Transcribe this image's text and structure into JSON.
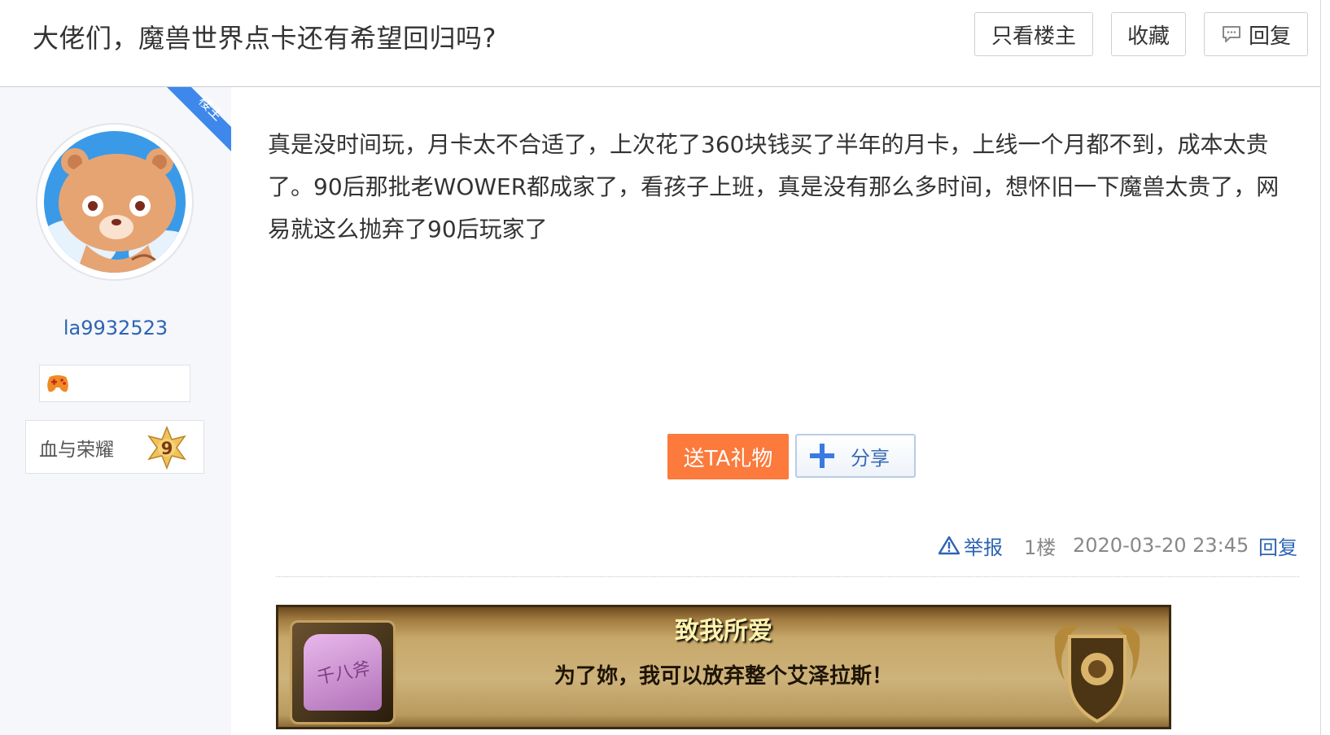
{
  "thread": {
    "title": "大佬们，魔兽世界点卡还有希望回归吗?",
    "actions": {
      "only_op": "只看楼主",
      "favorite": "收藏",
      "reply": "回复"
    }
  },
  "author": {
    "badge": "楼主",
    "username": "la9932523",
    "rank_name": "血与荣耀",
    "level": "9"
  },
  "post": {
    "content": "真是没时间玩，月卡太不合适了，上次花了360块钱买了半年的月卡，上线一个月都不到，成本太贵了。90后那批老WOWER都成家了，看孩子上班，真是没有那么多时间，想怀旧一下魔兽太贵了，网易就这么抛弃了90后玩家了",
    "gift_button": "送TA礼物",
    "share_button": "分享",
    "report": "举报",
    "floor": "1楼",
    "time": "2020-03-20 23:45",
    "reply": "回复"
  },
  "signature": {
    "title": "致我所爱",
    "subtitle": "为了妳，我可以放弃整个艾泽拉斯！",
    "item_icon_text": "千八斧"
  },
  "colors": {
    "link_blue": "#2d64b3",
    "gift_orange": "#fb7a3c",
    "op_badge_blue": "#3d88ea",
    "sidebar_bg": "#f6f7fb"
  }
}
